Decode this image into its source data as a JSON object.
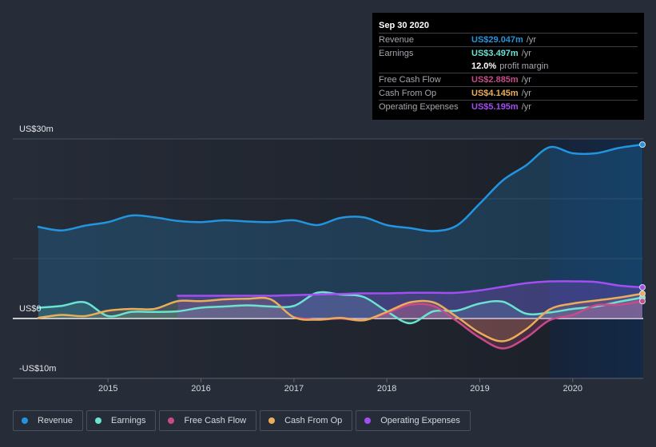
{
  "tooltip": {
    "date": "Sep 30 2020",
    "rows": [
      {
        "label": "Revenue",
        "value": "US$29.047m",
        "unit": "/yr",
        "color": "#2394df"
      },
      {
        "label": "Earnings",
        "value": "US$3.497m",
        "unit": "/yr",
        "color": "#6ce3d1"
      },
      {
        "label": "",
        "value": "12.0%",
        "unit": "profit margin",
        "color": "#ffffff"
      },
      {
        "label": "Free Cash Flow",
        "value": "US$2.885m",
        "unit": "/yr",
        "color": "#c94a8a"
      },
      {
        "label": "Cash From Op",
        "value": "US$4.145m",
        "unit": "/yr",
        "color": "#eaae5b"
      },
      {
        "label": "Operating Expenses",
        "value": "US$5.195m",
        "unit": "/yr",
        "color": "#a24ef0"
      }
    ]
  },
  "legend": [
    {
      "label": "Revenue",
      "color": "#2394df"
    },
    {
      "label": "Earnings",
      "color": "#6ce3d1"
    },
    {
      "label": "Free Cash Flow",
      "color": "#c94a8a"
    },
    {
      "label": "Cash From Op",
      "color": "#eaae5b"
    },
    {
      "label": "Operating Expenses",
      "color": "#a24ef0"
    }
  ],
  "chart_data": {
    "type": "line",
    "title": "",
    "xlabel": "",
    "ylabel": "",
    "y_tick_labels": [
      "US$30m",
      "US$0",
      "-US$10m"
    ],
    "x_tick_labels": [
      "2015",
      "2016",
      "2017",
      "2018",
      "2019",
      "2020"
    ],
    "xlim": [
      2014.25,
      2020.75
    ],
    "ylim": [
      -10,
      30
    ],
    "highlight_from": 2019.75,
    "grid": true,
    "legend_position": "bottom",
    "x": [
      2014.25,
      2014.5,
      2014.75,
      2015.0,
      2015.25,
      2015.5,
      2015.75,
      2016.0,
      2016.25,
      2016.5,
      2016.75,
      2017.0,
      2017.25,
      2017.5,
      2017.75,
      2018.0,
      2018.25,
      2018.5,
      2018.75,
      2019.0,
      2019.25,
      2019.5,
      2019.75,
      2020.0,
      2020.25,
      2020.5,
      2020.75
    ],
    "series": [
      {
        "name": "Revenue",
        "color": "#2394df",
        "values": [
          15.3,
          14.7,
          15.5,
          16.1,
          17.2,
          16.9,
          16.3,
          16.1,
          16.4,
          16.2,
          16.1,
          16.4,
          15.6,
          16.8,
          16.9,
          15.6,
          15.1,
          14.6,
          15.5,
          19.2,
          23.1,
          25.6,
          28.6,
          27.6,
          27.6,
          28.5,
          29.05
        ]
      },
      {
        "name": "Earnings",
        "color": "#6ce3d1",
        "values": [
          1.8,
          2.1,
          2.7,
          0.4,
          1.1,
          1.1,
          1.2,
          1.8,
          2.0,
          2.2,
          2.0,
          2.1,
          4.3,
          4.0,
          3.6,
          1.2,
          -0.8,
          1.2,
          1.3,
          2.5,
          2.8,
          0.8,
          1.0,
          1.6,
          2.0,
          2.8,
          3.5
        ]
      },
      {
        "name": "Free Cash Flow",
        "color": "#c94a8a",
        "values": [
          null,
          null,
          null,
          null,
          null,
          null,
          null,
          null,
          null,
          null,
          null,
          0.2,
          -0.2,
          0.0,
          -0.3,
          0.9,
          2.3,
          2.1,
          -0.4,
          -3.2,
          -5.0,
          -3.2,
          -0.3,
          0.6,
          2.2,
          2.3,
          2.9
        ]
      },
      {
        "name": "Cash From Op",
        "color": "#eaae5b",
        "values": [
          0.1,
          0.6,
          0.4,
          1.3,
          1.6,
          1.6,
          2.9,
          2.9,
          3.2,
          3.3,
          3.2,
          0.2,
          -0.2,
          0.1,
          -0.3,
          1.1,
          2.7,
          2.7,
          0.3,
          -2.4,
          -3.8,
          -1.8,
          1.5,
          2.5,
          3.0,
          3.5,
          4.15
        ]
      },
      {
        "name": "Operating Expenses",
        "color": "#a24ef0",
        "values": [
          null,
          null,
          null,
          null,
          null,
          null,
          3.8,
          3.8,
          3.8,
          3.8,
          3.8,
          3.9,
          4.0,
          4.1,
          4.2,
          4.2,
          4.3,
          4.3,
          4.3,
          4.7,
          5.3,
          5.9,
          6.2,
          6.2,
          6.1,
          5.5,
          5.2
        ]
      }
    ]
  }
}
